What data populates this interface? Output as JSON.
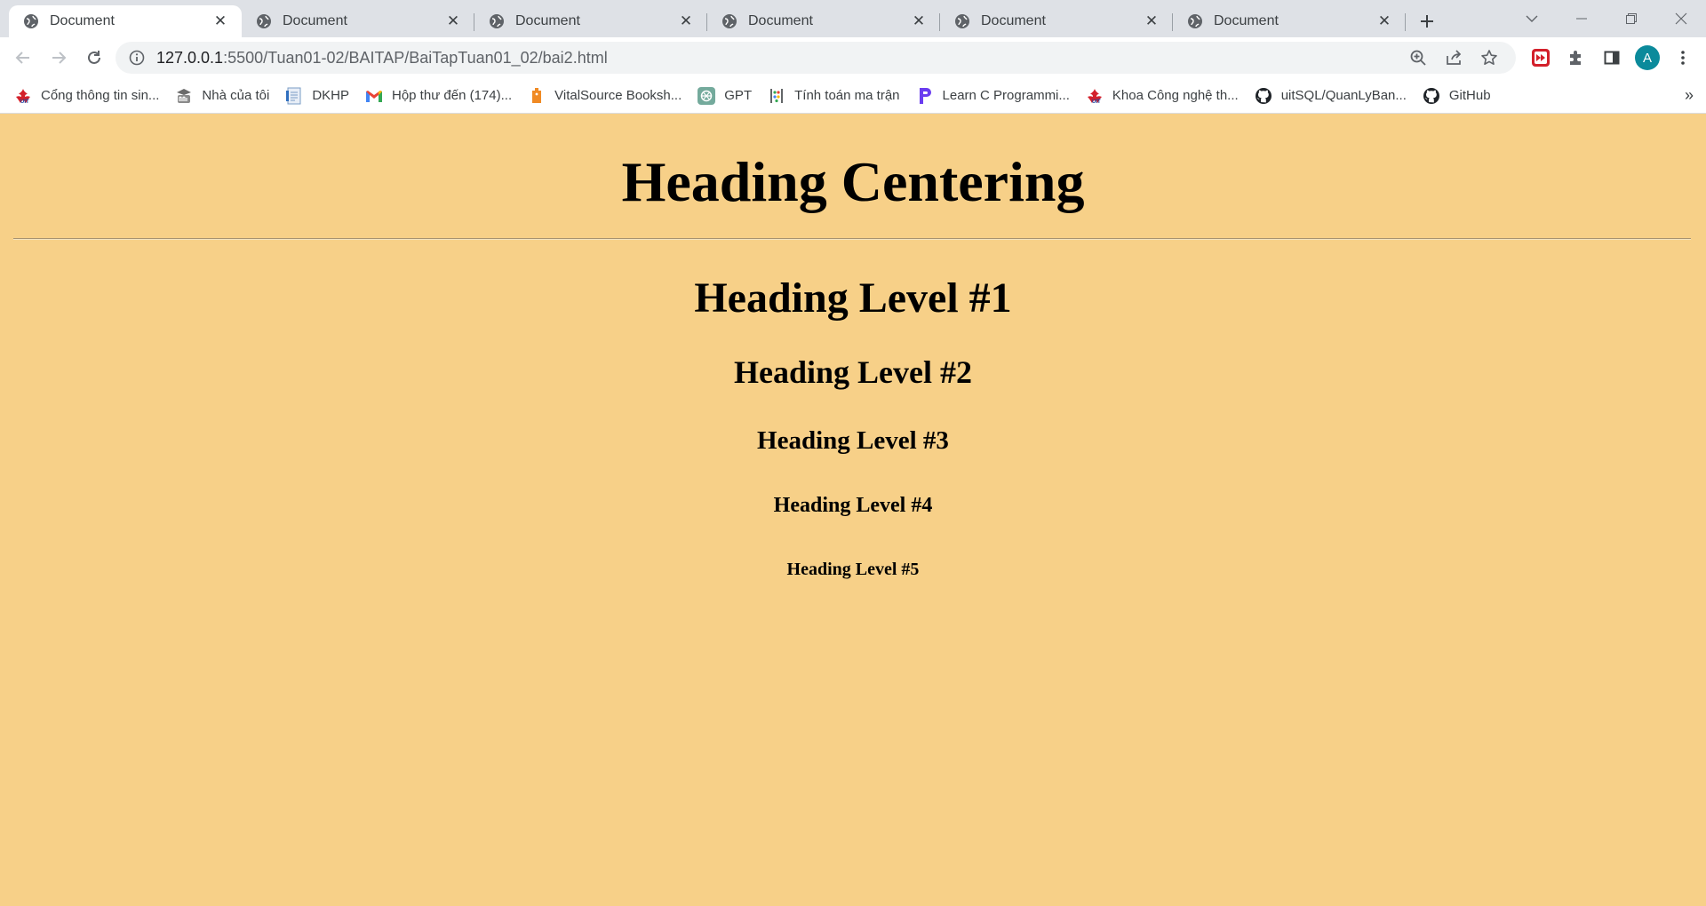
{
  "tabs": [
    {
      "title": "Document",
      "close": "✕"
    },
    {
      "title": "Document",
      "close": "✕"
    },
    {
      "title": "Document",
      "close": "✕"
    },
    {
      "title": "Document",
      "close": "✕"
    },
    {
      "title": "Document",
      "close": "✕"
    },
    {
      "title": "Document",
      "close": "✕"
    }
  ],
  "toolbar": {
    "url_host": "127.0.0.1",
    "url_path": ":5500/Tuan01-02/BAITAP/BaiTapTuan01_02/bai2.html",
    "avatar_letter": "A"
  },
  "bookmarks": [
    {
      "label": "Cổng thông tin sin...",
      "icon": "uit-logo-icon"
    },
    {
      "label": "Nhà của tôi",
      "icon": "moodle-icon"
    },
    {
      "label": "DKHP",
      "icon": "document-icon"
    },
    {
      "label": "Hộp thư đến (174)...",
      "icon": "gmail-icon"
    },
    {
      "label": "VitalSource Booksh...",
      "icon": "vitalsource-icon"
    },
    {
      "label": "GPT",
      "icon": "openai-icon"
    },
    {
      "label": "Tính toán ma trận",
      "icon": "matrix-icon"
    },
    {
      "label": "Learn C Programmi...",
      "icon": "programiz-icon"
    },
    {
      "label": "Khoa Công nghệ th...",
      "icon": "uit-logo-icon"
    },
    {
      "label": "uitSQL/QuanLyBan...",
      "icon": "github-icon"
    },
    {
      "label": "GitHub",
      "icon": "github-icon"
    }
  ],
  "bookmarks_more": "»",
  "page": {
    "title": "Heading Centering",
    "h1": "Heading Level #1",
    "h2": "Heading Level #2",
    "h3": "Heading Level #3",
    "h4": "Heading Level #4",
    "h5": "Heading Level #5"
  },
  "colors": {
    "page_background": "#f7d088",
    "tabstrip": "#dee1e6",
    "avatar": "#0b8a9b"
  }
}
